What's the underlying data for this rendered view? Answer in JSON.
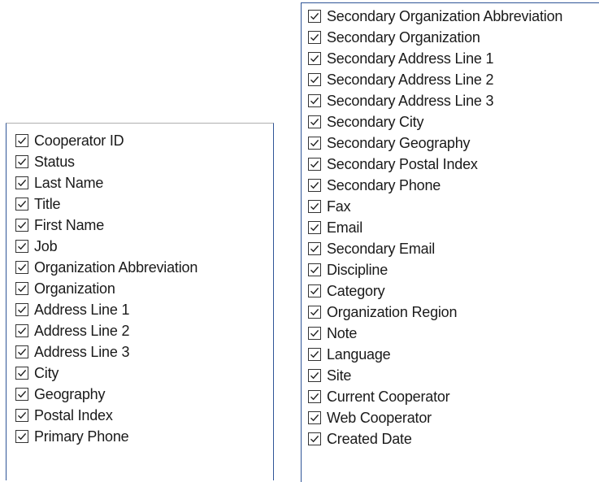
{
  "left_panel": {
    "items": [
      {
        "label": "Cooperator ID",
        "checked": true
      },
      {
        "label": "Status",
        "checked": true
      },
      {
        "label": "Last Name",
        "checked": true
      },
      {
        "label": "Title",
        "checked": true
      },
      {
        "label": "First Name",
        "checked": true
      },
      {
        "label": "Job",
        "checked": true
      },
      {
        "label": "Organization Abbreviation",
        "checked": true
      },
      {
        "label": "Organization",
        "checked": true
      },
      {
        "label": "Address Line 1",
        "checked": true
      },
      {
        "label": "Address Line 2",
        "checked": true
      },
      {
        "label": "Address Line 3",
        "checked": true
      },
      {
        "label": "City",
        "checked": true
      },
      {
        "label": "Geography",
        "checked": true
      },
      {
        "label": "Postal Index",
        "checked": true
      },
      {
        "label": "Primary Phone",
        "checked": true
      }
    ]
  },
  "right_panel": {
    "items": [
      {
        "label": "Secondary Organization Abbreviation",
        "checked": true
      },
      {
        "label": "Secondary Organization",
        "checked": true
      },
      {
        "label": "Secondary Address Line 1",
        "checked": true
      },
      {
        "label": "Secondary Address Line 2",
        "checked": true
      },
      {
        "label": "Secondary Address Line 3",
        "checked": true
      },
      {
        "label": "Secondary City",
        "checked": true
      },
      {
        "label": "Secondary Geography",
        "checked": true
      },
      {
        "label": "Secondary Postal Index",
        "checked": true
      },
      {
        "label": "Secondary Phone",
        "checked": true
      },
      {
        "label": "Fax",
        "checked": true
      },
      {
        "label": "Email",
        "checked": true
      },
      {
        "label": "Secondary Email",
        "checked": true
      },
      {
        "label": "Discipline",
        "checked": true
      },
      {
        "label": "Category",
        "checked": true
      },
      {
        "label": "Organization Region",
        "checked": true
      },
      {
        "label": "Note",
        "checked": true
      },
      {
        "label": "Language",
        "checked": true
      },
      {
        "label": "Site",
        "checked": true
      },
      {
        "label": "Current Cooperator",
        "checked": true
      },
      {
        "label": "Web Cooperator",
        "checked": true
      },
      {
        "label": "Created Date",
        "checked": true
      }
    ]
  },
  "colors": {
    "panel_border": "#2f5597",
    "checkbox_border": "#333333",
    "checkmark": "#222222",
    "text": "#1a1a1a"
  },
  "icons": {
    "checkbox_checked": "checkmark-icon"
  }
}
